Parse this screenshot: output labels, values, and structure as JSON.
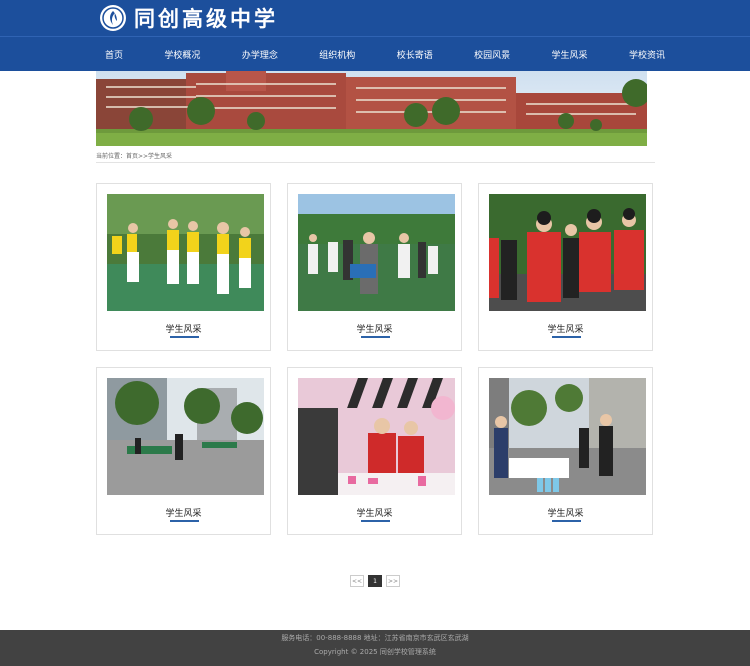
{
  "header": {
    "site_name": "同创高级中学"
  },
  "nav": [
    "首页",
    "学校概况",
    "办学理念",
    "组织机构",
    "校长寄语",
    "校园风景",
    "学生风采",
    "学校资讯"
  ],
  "breadcrumb": {
    "text": "当前位置：首页>>学生风采"
  },
  "cards": [
    {
      "caption": "学生风采"
    },
    {
      "caption": "学生风采"
    },
    {
      "caption": "学生风采"
    },
    {
      "caption": "学生风采"
    },
    {
      "caption": "学生风采"
    },
    {
      "caption": "学生风采"
    }
  ],
  "pagination": {
    "prev": "<<",
    "current": "1",
    "next": ">>"
  },
  "footer": {
    "line1": "服务电话：00-888-8888 地址：江苏省南京市玄武区玄武湖",
    "line2": "Copyright © 2025 同创学校管理系统"
  }
}
